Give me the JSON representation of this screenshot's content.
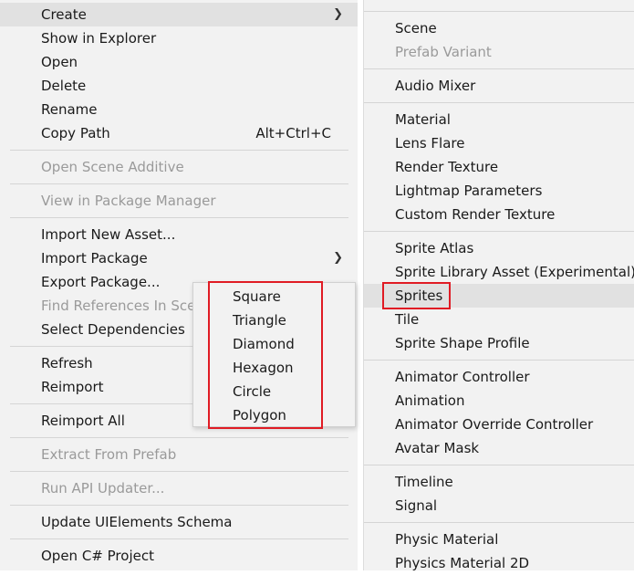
{
  "main_menu": {
    "create": "Create",
    "show_in_explorer": "Show in Explorer",
    "open": "Open",
    "delete": "Delete",
    "rename": "Rename",
    "copy_path": "Copy Path",
    "copy_path_shortcut": "Alt+Ctrl+C",
    "open_scene_additive": "Open Scene Additive",
    "view_in_package_manager": "View in Package Manager",
    "import_new_asset": "Import New Asset...",
    "import_package": "Import Package",
    "export_package": "Export Package...",
    "find_references": "Find References In Scene",
    "select_dependencies": "Select Dependencies",
    "refresh": "Refresh",
    "reimport": "Reimport",
    "reimport_all": "Reimport All",
    "extract_from_prefab": "Extract From Prefab",
    "run_api_updater": "Run API Updater...",
    "update_uielements_schema": "Update UIElements Schema",
    "open_csharp_project": "Open C# Project"
  },
  "create_menu": {
    "scene": "Scene",
    "prefab_variant": "Prefab Variant",
    "audio_mixer": "Audio Mixer",
    "material": "Material",
    "lens_flare": "Lens Flare",
    "render_texture": "Render Texture",
    "lightmap_parameters": "Lightmap Parameters",
    "custom_render_texture": "Custom Render Texture",
    "sprite_atlas": "Sprite Atlas",
    "sprite_library_asset": "Sprite Library Asset (Experimental)",
    "sprites": "Sprites",
    "tile": "Tile",
    "sprite_shape_profile": "Sprite Shape Profile",
    "animator_controller": "Animator Controller",
    "animation": "Animation",
    "animator_override_controller": "Animator Override Controller",
    "avatar_mask": "Avatar Mask",
    "timeline": "Timeline",
    "signal": "Signal",
    "physic_material": "Physic Material",
    "physics_material_2d": "Physics Material 2D"
  },
  "sprites_menu": {
    "square": "Square",
    "triangle": "Triangle",
    "diamond": "Diamond",
    "hexagon": "Hexagon",
    "circle": "Circle",
    "polygon": "Polygon"
  },
  "icons": {
    "submenu_arrow": "chevron-right-icon"
  },
  "colors": {
    "menu_background": "#f2f2f2",
    "hover_background": "#e1e1e1",
    "disabled_text": "#9a9a9a",
    "highlight_border": "#e01b24"
  }
}
